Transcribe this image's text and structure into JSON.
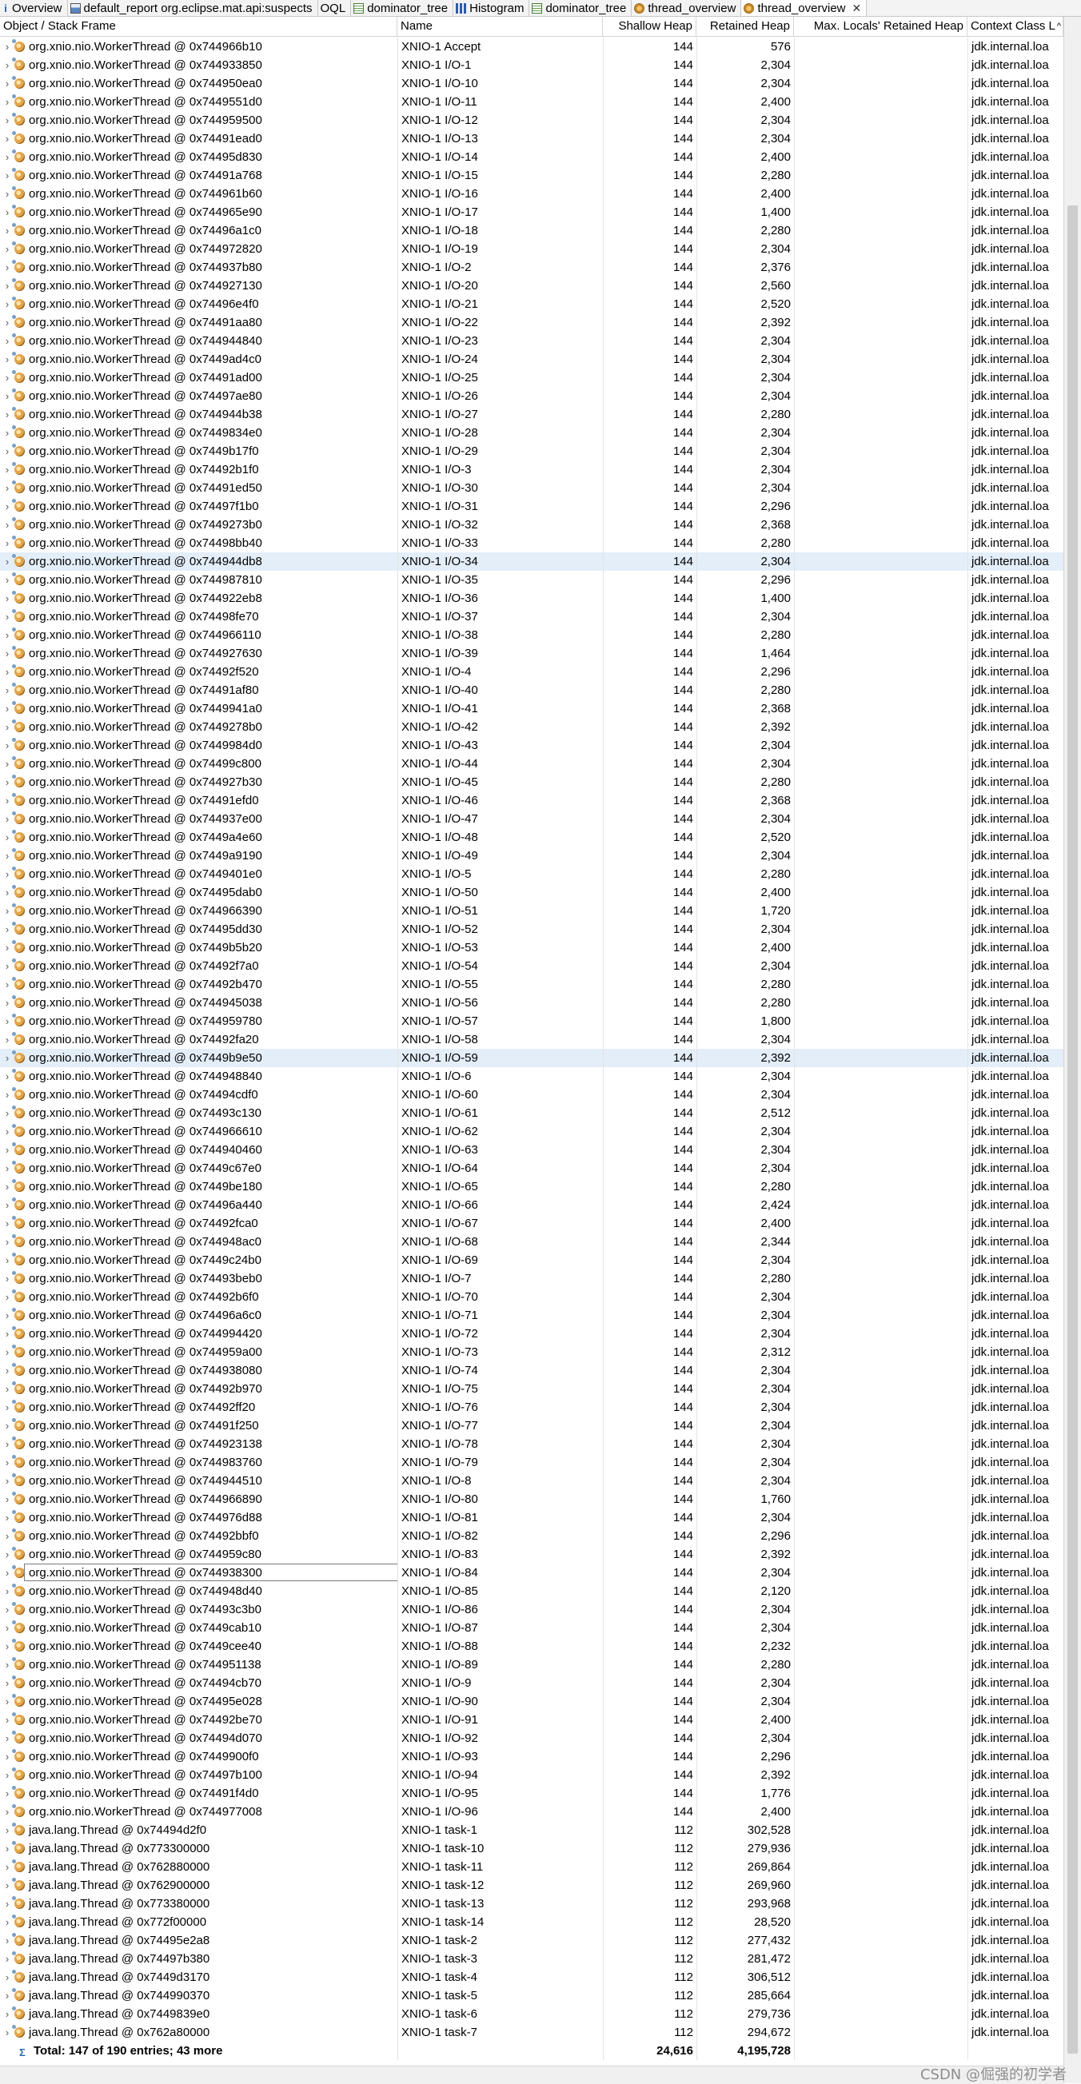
{
  "tabs": [
    {
      "label": "Overview",
      "icon": "info-icon",
      "active": false
    },
    {
      "label": "default_report org.eclipse.mat.api:suspects",
      "icon": "report-icon",
      "active": false
    },
    {
      "label": "OQL",
      "icon": "query-icon",
      "active": false
    },
    {
      "label": "dominator_tree",
      "icon": "tree-icon",
      "active": false
    },
    {
      "label": "Histogram",
      "icon": "histogram-icon",
      "active": false
    },
    {
      "label": "dominator_tree",
      "icon": "tree-icon",
      "active": false
    },
    {
      "label": "thread_overview",
      "icon": "thread-icon",
      "active": false
    },
    {
      "label": "thread_overview",
      "icon": "thread-icon",
      "active": true
    }
  ],
  "columns": {
    "object": "Object / Stack Frame",
    "name": "Name",
    "shallow": "Shallow Heap",
    "retained": "Retained Heap",
    "max_locals": "Max. Locals' Retained Heap",
    "context": "Context Class L"
  },
  "ctx_value": "jdk.internal.loa",
  "rows": [
    {
      "obj": "org.xnio.nio.WorkerThread @ 0x744966b10",
      "name": "XNIO-1 Accept",
      "shallow": "144",
      "retained": "576"
    },
    {
      "obj": "org.xnio.nio.WorkerThread @ 0x744933850",
      "name": "XNIO-1 I/O-1",
      "shallow": "144",
      "retained": "2,304"
    },
    {
      "obj": "org.xnio.nio.WorkerThread @ 0x744950ea0",
      "name": "XNIO-1 I/O-10",
      "shallow": "144",
      "retained": "2,304"
    },
    {
      "obj": "org.xnio.nio.WorkerThread @ 0x7449551d0",
      "name": "XNIO-1 I/O-11",
      "shallow": "144",
      "retained": "2,400"
    },
    {
      "obj": "org.xnio.nio.WorkerThread @ 0x744959500",
      "name": "XNIO-1 I/O-12",
      "shallow": "144",
      "retained": "2,304"
    },
    {
      "obj": "org.xnio.nio.WorkerThread @ 0x74491ead0",
      "name": "XNIO-1 I/O-13",
      "shallow": "144",
      "retained": "2,304"
    },
    {
      "obj": "org.xnio.nio.WorkerThread @ 0x74495d830",
      "name": "XNIO-1 I/O-14",
      "shallow": "144",
      "retained": "2,400"
    },
    {
      "obj": "org.xnio.nio.WorkerThread @ 0x74491a768",
      "name": "XNIO-1 I/O-15",
      "shallow": "144",
      "retained": "2,280"
    },
    {
      "obj": "org.xnio.nio.WorkerThread @ 0x744961b60",
      "name": "XNIO-1 I/O-16",
      "shallow": "144",
      "retained": "2,400"
    },
    {
      "obj": "org.xnio.nio.WorkerThread @ 0x744965e90",
      "name": "XNIO-1 I/O-17",
      "shallow": "144",
      "retained": "1,400"
    },
    {
      "obj": "org.xnio.nio.WorkerThread @ 0x74496a1c0",
      "name": "XNIO-1 I/O-18",
      "shallow": "144",
      "retained": "2,280"
    },
    {
      "obj": "org.xnio.nio.WorkerThread @ 0x744972820",
      "name": "XNIO-1 I/O-19",
      "shallow": "144",
      "retained": "2,304"
    },
    {
      "obj": "org.xnio.nio.WorkerThread @ 0x744937b80",
      "name": "XNIO-1 I/O-2",
      "shallow": "144",
      "retained": "2,376"
    },
    {
      "obj": "org.xnio.nio.WorkerThread @ 0x744927130",
      "name": "XNIO-1 I/O-20",
      "shallow": "144",
      "retained": "2,560"
    },
    {
      "obj": "org.xnio.nio.WorkerThread @ 0x74496e4f0",
      "name": "XNIO-1 I/O-21",
      "shallow": "144",
      "retained": "2,520"
    },
    {
      "obj": "org.xnio.nio.WorkerThread @ 0x74491aa80",
      "name": "XNIO-1 I/O-22",
      "shallow": "144",
      "retained": "2,392"
    },
    {
      "obj": "org.xnio.nio.WorkerThread @ 0x744944840",
      "name": "XNIO-1 I/O-23",
      "shallow": "144",
      "retained": "2,304"
    },
    {
      "obj": "org.xnio.nio.WorkerThread @ 0x7449ad4c0",
      "name": "XNIO-1 I/O-24",
      "shallow": "144",
      "retained": "2,304"
    },
    {
      "obj": "org.xnio.nio.WorkerThread @ 0x74491ad00",
      "name": "XNIO-1 I/O-25",
      "shallow": "144",
      "retained": "2,304"
    },
    {
      "obj": "org.xnio.nio.WorkerThread @ 0x74497ae80",
      "name": "XNIO-1 I/O-26",
      "shallow": "144",
      "retained": "2,304"
    },
    {
      "obj": "org.xnio.nio.WorkerThread @ 0x744944b38",
      "name": "XNIO-1 I/O-27",
      "shallow": "144",
      "retained": "2,280"
    },
    {
      "obj": "org.xnio.nio.WorkerThread @ 0x7449834e0",
      "name": "XNIO-1 I/O-28",
      "shallow": "144",
      "retained": "2,304"
    },
    {
      "obj": "org.xnio.nio.WorkerThread @ 0x7449b17f0",
      "name": "XNIO-1 I/O-29",
      "shallow": "144",
      "retained": "2,304"
    },
    {
      "obj": "org.xnio.nio.WorkerThread @ 0x74492b1f0",
      "name": "XNIO-1 I/O-3",
      "shallow": "144",
      "retained": "2,304"
    },
    {
      "obj": "org.xnio.nio.WorkerThread @ 0x74491ed50",
      "name": "XNIO-1 I/O-30",
      "shallow": "144",
      "retained": "2,304"
    },
    {
      "obj": "org.xnio.nio.WorkerThread @ 0x74497f1b0",
      "name": "XNIO-1 I/O-31",
      "shallow": "144",
      "retained": "2,296"
    },
    {
      "obj": "org.xnio.nio.WorkerThread @ 0x7449273b0",
      "name": "XNIO-1 I/O-32",
      "shallow": "144",
      "retained": "2,368"
    },
    {
      "obj": "org.xnio.nio.WorkerThread @ 0x74498bb40",
      "name": "XNIO-1 I/O-33",
      "shallow": "144",
      "retained": "2,280"
    },
    {
      "obj": "org.xnio.nio.WorkerThread @ 0x744944db8",
      "name": "XNIO-1 I/O-34",
      "shallow": "144",
      "retained": "2,304",
      "selected": true
    },
    {
      "obj": "org.xnio.nio.WorkerThread @ 0x744987810",
      "name": "XNIO-1 I/O-35",
      "shallow": "144",
      "retained": "2,296"
    },
    {
      "obj": "org.xnio.nio.WorkerThread @ 0x744922eb8",
      "name": "XNIO-1 I/O-36",
      "shallow": "144",
      "retained": "1,400"
    },
    {
      "obj": "org.xnio.nio.WorkerThread @ 0x74498fe70",
      "name": "XNIO-1 I/O-37",
      "shallow": "144",
      "retained": "2,304"
    },
    {
      "obj": "org.xnio.nio.WorkerThread @ 0x744966110",
      "name": "XNIO-1 I/O-38",
      "shallow": "144",
      "retained": "2,280"
    },
    {
      "obj": "org.xnio.nio.WorkerThread @ 0x744927630",
      "name": "XNIO-1 I/O-39",
      "shallow": "144",
      "retained": "1,464"
    },
    {
      "obj": "org.xnio.nio.WorkerThread @ 0x74492f520",
      "name": "XNIO-1 I/O-4",
      "shallow": "144",
      "retained": "2,296"
    },
    {
      "obj": "org.xnio.nio.WorkerThread @ 0x74491af80",
      "name": "XNIO-1 I/O-40",
      "shallow": "144",
      "retained": "2,280"
    },
    {
      "obj": "org.xnio.nio.WorkerThread @ 0x7449941a0",
      "name": "XNIO-1 I/O-41",
      "shallow": "144",
      "retained": "2,368"
    },
    {
      "obj": "org.xnio.nio.WorkerThread @ 0x7449278b0",
      "name": "XNIO-1 I/O-42",
      "shallow": "144",
      "retained": "2,392"
    },
    {
      "obj": "org.xnio.nio.WorkerThread @ 0x7449984d0",
      "name": "XNIO-1 I/O-43",
      "shallow": "144",
      "retained": "2,304"
    },
    {
      "obj": "org.xnio.nio.WorkerThread @ 0x74499c800",
      "name": "XNIO-1 I/O-44",
      "shallow": "144",
      "retained": "2,304"
    },
    {
      "obj": "org.xnio.nio.WorkerThread @ 0x744927b30",
      "name": "XNIO-1 I/O-45",
      "shallow": "144",
      "retained": "2,280"
    },
    {
      "obj": "org.xnio.nio.WorkerThread @ 0x74491efd0",
      "name": "XNIO-1 I/O-46",
      "shallow": "144",
      "retained": "2,368"
    },
    {
      "obj": "org.xnio.nio.WorkerThread @ 0x744937e00",
      "name": "XNIO-1 I/O-47",
      "shallow": "144",
      "retained": "2,304"
    },
    {
      "obj": "org.xnio.nio.WorkerThread @ 0x7449a4e60",
      "name": "XNIO-1 I/O-48",
      "shallow": "144",
      "retained": "2,520"
    },
    {
      "obj": "org.xnio.nio.WorkerThread @ 0x7449a9190",
      "name": "XNIO-1 I/O-49",
      "shallow": "144",
      "retained": "2,304"
    },
    {
      "obj": "org.xnio.nio.WorkerThread @ 0x7449401e0",
      "name": "XNIO-1 I/O-5",
      "shallow": "144",
      "retained": "2,280"
    },
    {
      "obj": "org.xnio.nio.WorkerThread @ 0x74495dab0",
      "name": "XNIO-1 I/O-50",
      "shallow": "144",
      "retained": "2,400"
    },
    {
      "obj": "org.xnio.nio.WorkerThread @ 0x744966390",
      "name": "XNIO-1 I/O-51",
      "shallow": "144",
      "retained": "1,720"
    },
    {
      "obj": "org.xnio.nio.WorkerThread @ 0x74495dd30",
      "name": "XNIO-1 I/O-52",
      "shallow": "144",
      "retained": "2,304"
    },
    {
      "obj": "org.xnio.nio.WorkerThread @ 0x7449b5b20",
      "name": "XNIO-1 I/O-53",
      "shallow": "144",
      "retained": "2,400"
    },
    {
      "obj": "org.xnio.nio.WorkerThread @ 0x74492f7a0",
      "name": "XNIO-1 I/O-54",
      "shallow": "144",
      "retained": "2,304"
    },
    {
      "obj": "org.xnio.nio.WorkerThread @ 0x74492b470",
      "name": "XNIO-1 I/O-55",
      "shallow": "144",
      "retained": "2,280"
    },
    {
      "obj": "org.xnio.nio.WorkerThread @ 0x744945038",
      "name": "XNIO-1 I/O-56",
      "shallow": "144",
      "retained": "2,280"
    },
    {
      "obj": "org.xnio.nio.WorkerThread @ 0x744959780",
      "name": "XNIO-1 I/O-57",
      "shallow": "144",
      "retained": "1,800"
    },
    {
      "obj": "org.xnio.nio.WorkerThread @ 0x74492fa20",
      "name": "XNIO-1 I/O-58",
      "shallow": "144",
      "retained": "2,304"
    },
    {
      "obj": "org.xnio.nio.WorkerThread @ 0x7449b9e50",
      "name": "XNIO-1 I/O-59",
      "shallow": "144",
      "retained": "2,392",
      "selected": true
    },
    {
      "obj": "org.xnio.nio.WorkerThread @ 0x744948840",
      "name": "XNIO-1 I/O-6",
      "shallow": "144",
      "retained": "2,304"
    },
    {
      "obj": "org.xnio.nio.WorkerThread @ 0x74494cdf0",
      "name": "XNIO-1 I/O-60",
      "shallow": "144",
      "retained": "2,304"
    },
    {
      "obj": "org.xnio.nio.WorkerThread @ 0x74493c130",
      "name": "XNIO-1 I/O-61",
      "shallow": "144",
      "retained": "2,512"
    },
    {
      "obj": "org.xnio.nio.WorkerThread @ 0x744966610",
      "name": "XNIO-1 I/O-62",
      "shallow": "144",
      "retained": "2,304"
    },
    {
      "obj": "org.xnio.nio.WorkerThread @ 0x744940460",
      "name": "XNIO-1 I/O-63",
      "shallow": "144",
      "retained": "2,304"
    },
    {
      "obj": "org.xnio.nio.WorkerThread @ 0x7449c67e0",
      "name": "XNIO-1 I/O-64",
      "shallow": "144",
      "retained": "2,304"
    },
    {
      "obj": "org.xnio.nio.WorkerThread @ 0x7449be180",
      "name": "XNIO-1 I/O-65",
      "shallow": "144",
      "retained": "2,280"
    },
    {
      "obj": "org.xnio.nio.WorkerThread @ 0x74496a440",
      "name": "XNIO-1 I/O-66",
      "shallow": "144",
      "retained": "2,424"
    },
    {
      "obj": "org.xnio.nio.WorkerThread @ 0x74492fca0",
      "name": "XNIO-1 I/O-67",
      "shallow": "144",
      "retained": "2,400"
    },
    {
      "obj": "org.xnio.nio.WorkerThread @ 0x744948ac0",
      "name": "XNIO-1 I/O-68",
      "shallow": "144",
      "retained": "2,344"
    },
    {
      "obj": "org.xnio.nio.WorkerThread @ 0x7449c24b0",
      "name": "XNIO-1 I/O-69",
      "shallow": "144",
      "retained": "2,304"
    },
    {
      "obj": "org.xnio.nio.WorkerThread @ 0x74493beb0",
      "name": "XNIO-1 I/O-7",
      "shallow": "144",
      "retained": "2,280"
    },
    {
      "obj": "org.xnio.nio.WorkerThread @ 0x74492b6f0",
      "name": "XNIO-1 I/O-70",
      "shallow": "144",
      "retained": "2,304"
    },
    {
      "obj": "org.xnio.nio.WorkerThread @ 0x74496a6c0",
      "name": "XNIO-1 I/O-71",
      "shallow": "144",
      "retained": "2,304"
    },
    {
      "obj": "org.xnio.nio.WorkerThread @ 0x744994420",
      "name": "XNIO-1 I/O-72",
      "shallow": "144",
      "retained": "2,304"
    },
    {
      "obj": "org.xnio.nio.WorkerThread @ 0x744959a00",
      "name": "XNIO-1 I/O-73",
      "shallow": "144",
      "retained": "2,312"
    },
    {
      "obj": "org.xnio.nio.WorkerThread @ 0x744938080",
      "name": "XNIO-1 I/O-74",
      "shallow": "144",
      "retained": "2,304"
    },
    {
      "obj": "org.xnio.nio.WorkerThread @ 0x74492b970",
      "name": "XNIO-1 I/O-75",
      "shallow": "144",
      "retained": "2,304"
    },
    {
      "obj": "org.xnio.nio.WorkerThread @ 0x74492ff20",
      "name": "XNIO-1 I/O-76",
      "shallow": "144",
      "retained": "2,304"
    },
    {
      "obj": "org.xnio.nio.WorkerThread @ 0x74491f250",
      "name": "XNIO-1 I/O-77",
      "shallow": "144",
      "retained": "2,304"
    },
    {
      "obj": "org.xnio.nio.WorkerThread @ 0x744923138",
      "name": "XNIO-1 I/O-78",
      "shallow": "144",
      "retained": "2,304"
    },
    {
      "obj": "org.xnio.nio.WorkerThread @ 0x744983760",
      "name": "XNIO-1 I/O-79",
      "shallow": "144",
      "retained": "2,304"
    },
    {
      "obj": "org.xnio.nio.WorkerThread @ 0x744944510",
      "name": "XNIO-1 I/O-8",
      "shallow": "144",
      "retained": "2,304"
    },
    {
      "obj": "org.xnio.nio.WorkerThread @ 0x744966890",
      "name": "XNIO-1 I/O-80",
      "shallow": "144",
      "retained": "1,760"
    },
    {
      "obj": "org.xnio.nio.WorkerThread @ 0x744976d88",
      "name": "XNIO-1 I/O-81",
      "shallow": "144",
      "retained": "2,304"
    },
    {
      "obj": "org.xnio.nio.WorkerThread @ 0x74492bbf0",
      "name": "XNIO-1 I/O-82",
      "shallow": "144",
      "retained": "2,296"
    },
    {
      "obj": "org.xnio.nio.WorkerThread @ 0x744959c80",
      "name": "XNIO-1 I/O-83",
      "shallow": "144",
      "retained": "2,392"
    },
    {
      "obj": "org.xnio.nio.WorkerThread @ 0x744938300",
      "name": "XNIO-1 I/O-84",
      "shallow": "144",
      "retained": "2,304",
      "focused": true
    },
    {
      "obj": "org.xnio.nio.WorkerThread @ 0x744948d40",
      "name": "XNIO-1 I/O-85",
      "shallow": "144",
      "retained": "2,120"
    },
    {
      "obj": "org.xnio.nio.WorkerThread @ 0x74493c3b0",
      "name": "XNIO-1 I/O-86",
      "shallow": "144",
      "retained": "2,304"
    },
    {
      "obj": "org.xnio.nio.WorkerThread @ 0x7449cab10",
      "name": "XNIO-1 I/O-87",
      "shallow": "144",
      "retained": "2,304"
    },
    {
      "obj": "org.xnio.nio.WorkerThread @ 0x7449cee40",
      "name": "XNIO-1 I/O-88",
      "shallow": "144",
      "retained": "2,232"
    },
    {
      "obj": "org.xnio.nio.WorkerThread @ 0x744951138",
      "name": "XNIO-1 I/O-89",
      "shallow": "144",
      "retained": "2,280"
    },
    {
      "obj": "org.xnio.nio.WorkerThread @ 0x74494cb70",
      "name": "XNIO-1 I/O-9",
      "shallow": "144",
      "retained": "2,304"
    },
    {
      "obj": "org.xnio.nio.WorkerThread @ 0x74495e028",
      "name": "XNIO-1 I/O-90",
      "shallow": "144",
      "retained": "2,304"
    },
    {
      "obj": "org.xnio.nio.WorkerThread @ 0x74492be70",
      "name": "XNIO-1 I/O-91",
      "shallow": "144",
      "retained": "2,400"
    },
    {
      "obj": "org.xnio.nio.WorkerThread @ 0x74494d070",
      "name": "XNIO-1 I/O-92",
      "shallow": "144",
      "retained": "2,304"
    },
    {
      "obj": "org.xnio.nio.WorkerThread @ 0x7449900f0",
      "name": "XNIO-1 I/O-93",
      "shallow": "144",
      "retained": "2,296"
    },
    {
      "obj": "org.xnio.nio.WorkerThread @ 0x74497b100",
      "name": "XNIO-1 I/O-94",
      "shallow": "144",
      "retained": "2,392"
    },
    {
      "obj": "org.xnio.nio.WorkerThread @ 0x74491f4d0",
      "name": "XNIO-1 I/O-95",
      "shallow": "144",
      "retained": "1,776"
    },
    {
      "obj": "org.xnio.nio.WorkerThread @ 0x744977008",
      "name": "XNIO-1 I/O-96",
      "shallow": "144",
      "retained": "2,400"
    },
    {
      "obj": "java.lang.Thread @ 0x74494d2f0",
      "name": "XNIO-1 task-1",
      "shallow": "112",
      "retained": "302,528"
    },
    {
      "obj": "java.lang.Thread @ 0x773300000",
      "name": "XNIO-1 task-10",
      "shallow": "112",
      "retained": "279,936"
    },
    {
      "obj": "java.lang.Thread @ 0x762880000",
      "name": "XNIO-1 task-11",
      "shallow": "112",
      "retained": "269,864"
    },
    {
      "obj": "java.lang.Thread @ 0x762900000",
      "name": "XNIO-1 task-12",
      "shallow": "112",
      "retained": "269,960"
    },
    {
      "obj": "java.lang.Thread @ 0x773380000",
      "name": "XNIO-1 task-13",
      "shallow": "112",
      "retained": "293,968"
    },
    {
      "obj": "java.lang.Thread @ 0x772f00000",
      "name": "XNIO-1 task-14",
      "shallow": "112",
      "retained": "28,520"
    },
    {
      "obj": "java.lang.Thread @ 0x74495e2a8",
      "name": "XNIO-1 task-2",
      "shallow": "112",
      "retained": "277,432"
    },
    {
      "obj": "java.lang.Thread @ 0x74497b380",
      "name": "XNIO-1 task-3",
      "shallow": "112",
      "retained": "281,472"
    },
    {
      "obj": "java.lang.Thread @ 0x7449d3170",
      "name": "XNIO-1 task-4",
      "shallow": "112",
      "retained": "306,512"
    },
    {
      "obj": "java.lang.Thread @ 0x744990370",
      "name": "XNIO-1 task-5",
      "shallow": "112",
      "retained": "285,664"
    },
    {
      "obj": "java.lang.Thread @ 0x7449839e0",
      "name": "XNIO-1 task-6",
      "shallow": "112",
      "retained": "279,736"
    },
    {
      "obj": "java.lang.Thread @ 0x762a80000",
      "name": "XNIO-1 task-7",
      "shallow": "112",
      "retained": "294,672"
    }
  ],
  "total": {
    "label": "Total: 147 of 190 entries; 43 more",
    "shallow": "24,616",
    "retained": "4,195,728"
  },
  "watermark": "CSDN @倔强的初学者"
}
